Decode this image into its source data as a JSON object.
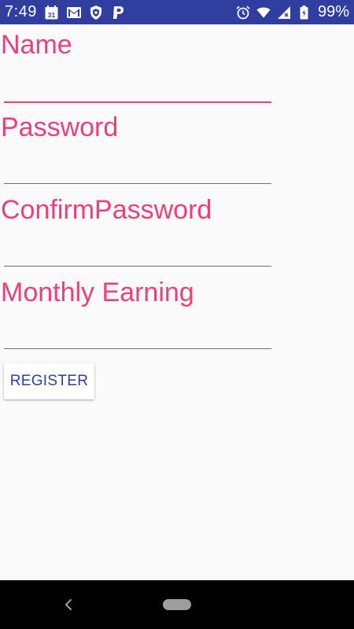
{
  "status_bar": {
    "time": "7:49",
    "calendar_day": "31",
    "battery_percent": "99%",
    "left_icons": [
      "calendar-icon",
      "gmail-icon",
      "shield-icon",
      "paypal-icon"
    ],
    "right_icons": [
      "alarm-icon",
      "wifi-icon",
      "signal-icon",
      "battery-icon"
    ],
    "background": "#303f9f"
  },
  "form": {
    "fields": [
      {
        "label": "Name",
        "value": "",
        "focused": true
      },
      {
        "label": "Password",
        "value": ""
      },
      {
        "label": "ConfirmPassword",
        "value": ""
      },
      {
        "label": "Monthly Earning",
        "value": ""
      }
    ],
    "register_label": "REGISTER"
  },
  "colors": {
    "accent": "#ec407a",
    "primary": "#303f9f",
    "background": "#fafafa"
  }
}
